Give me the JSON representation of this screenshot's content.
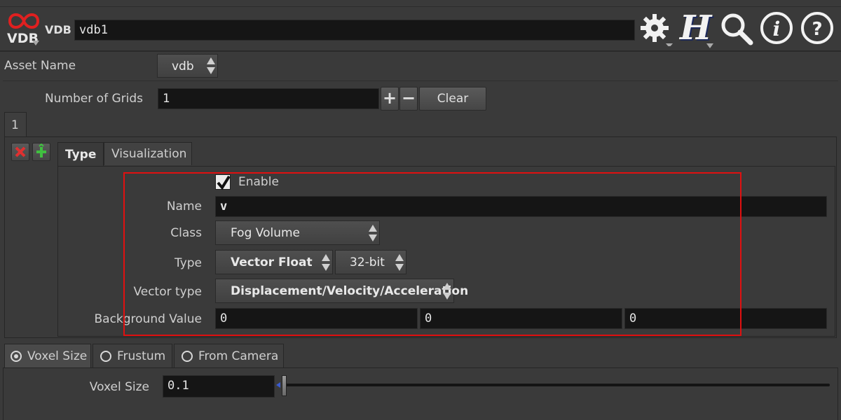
{
  "header": {
    "node_type": "VDB",
    "node_type_logo": "VDB",
    "node_name": "vdb1"
  },
  "toolbar_icons": [
    "gear-icon",
    "houdini-h-icon",
    "search-icon",
    "info-icon",
    "help-icon"
  ],
  "asset": {
    "label": "Asset Name",
    "value": "vdb"
  },
  "grids": {
    "label": "Number of Grids",
    "value": "1",
    "plus": "+",
    "minus": "−",
    "clear_label": "Clear",
    "multiparm_tab": "1"
  },
  "inner_tabs": [
    "Type",
    "Visualization"
  ],
  "grid": {
    "enable_label": "Enable",
    "enabled": true,
    "name_label": "Name",
    "name_value": "v",
    "class_label": "Class",
    "class_value": "Fog Volume",
    "type_label": "Type",
    "type_value": "Vector Float",
    "precision_value": "32-bit",
    "vector_type_label": "Vector type",
    "vector_type_value": "Displacement/Velocity/Acceleration",
    "background_label": "Background Value",
    "background_values": [
      "0",
      "0",
      "0"
    ]
  },
  "voxel_tabs": [
    {
      "label": "Voxel Size",
      "selected": true
    },
    {
      "label": "Frustum",
      "selected": false
    },
    {
      "label": "From Camera",
      "selected": false
    }
  ],
  "voxel": {
    "label": "Voxel Size",
    "value": "0.1"
  },
  "highlight_color": "#e01010"
}
